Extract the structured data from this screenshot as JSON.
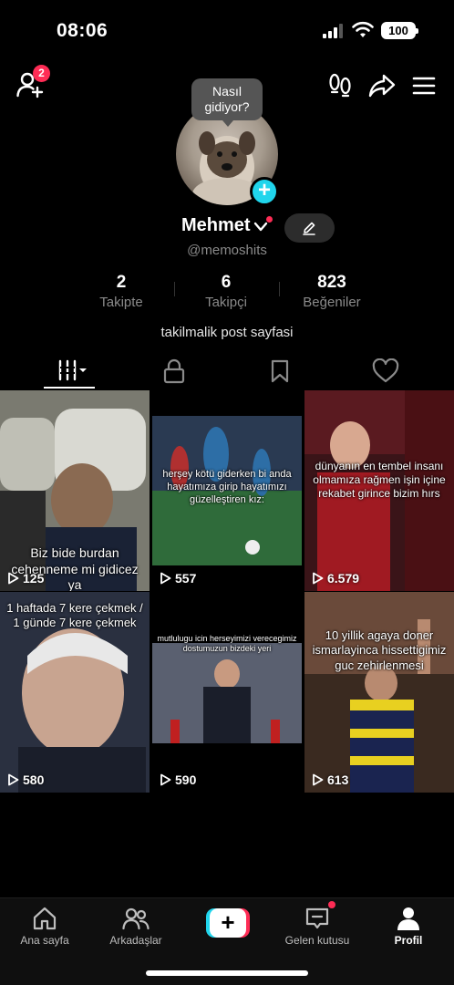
{
  "status_bar": {
    "time": "08:06",
    "battery": "100"
  },
  "header": {
    "add_friend_badge": "2",
    "bubble_text": "Nasıl gidiyor?"
  },
  "profile": {
    "name": "Mehmet",
    "username": "@memoshits",
    "bio": "takilmalik post sayfasi",
    "stats": [
      {
        "value": "2",
        "label": "Takipte"
      },
      {
        "value": "6",
        "label": "Takipçi"
      },
      {
        "value": "823",
        "label": "Beğeniler"
      }
    ]
  },
  "tabs": [
    "videos-tab",
    "private-tab",
    "saved-tab",
    "liked-tab"
  ],
  "videos": [
    {
      "caption": "Biz bide burdan cehenneme mi gidicez ya",
      "views": "125"
    },
    {
      "caption": "herşey kötü giderken bi anda hayatımıza girip hayatımızı güzelleştiren kız:",
      "views": "557"
    },
    {
      "caption": "dünyanın en tembel insanı olmamıza rağmen işin içine rekabet girince bizim hırs",
      "views": "6.579"
    },
    {
      "caption": "1 haftada 7 kere çekmek / 1 günde 7 kere çekmek",
      "views": "580"
    },
    {
      "caption": "mutlulugu icin herseyimizi verecegimiz dostumuzun bizdeki yeri",
      "views": "590"
    },
    {
      "caption": "10 yillik agaya doner ismarlayinca hissettigimiz guc zehirlenmesi",
      "views": "613"
    }
  ],
  "bottom_nav": {
    "home": "Ana sayfa",
    "friends": "Arkadaşlar",
    "inbox": "Gelen kutusu",
    "profile": "Profil"
  },
  "colors": {
    "accent_red": "#fe2c55",
    "accent_cyan": "#20d5ec",
    "background": "#000000"
  }
}
